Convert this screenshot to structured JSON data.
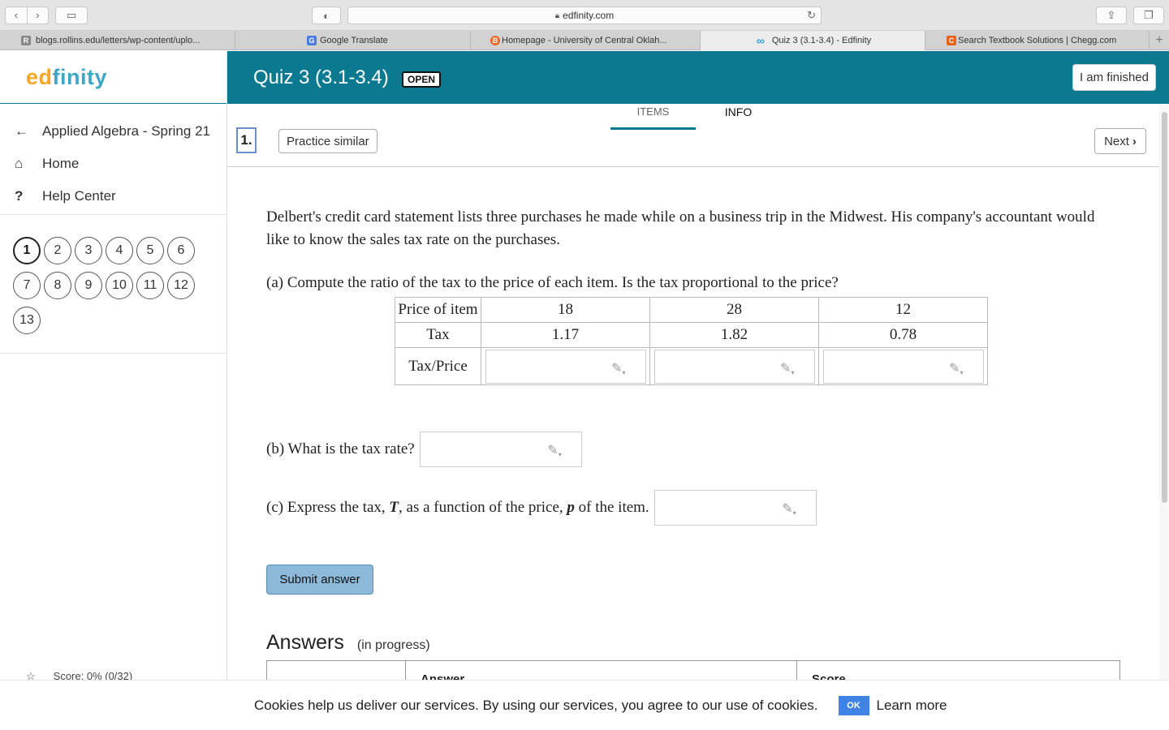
{
  "browser": {
    "url": "edfinity.com",
    "tabs": [
      {
        "label": "blogs.rollins.edu/letters/wp-content/uplo...",
        "favicon": "R",
        "color": "#888888"
      },
      {
        "label": "Google Translate",
        "favicon": "G",
        "color": "#4a7de0"
      },
      {
        "label": "Homepage - University of Central Oklah...",
        "favicon": "B",
        "color": "#e86a2b"
      },
      {
        "label": "Quiz 3 (3.1-3.4) - Edfinity",
        "favicon": "∞",
        "color": "#2a9fd6"
      },
      {
        "label": "Search Textbook Solutions | Chegg.com",
        "favicon": "C",
        "color": "#e8631a"
      }
    ]
  },
  "logo": {
    "part1": "ed",
    "part2": "finity"
  },
  "nav": {
    "course": "Applied Algebra - Spring 21",
    "home": "Home",
    "help": "Help Center"
  },
  "questions": {
    "row1": [
      "1",
      "2",
      "3",
      "4",
      "5",
      "6"
    ],
    "row2": [
      "7",
      "8",
      "9",
      "10",
      "11",
      "12"
    ],
    "row3": [
      "13"
    ],
    "current": "1"
  },
  "score": "Score: 0% (0/32)",
  "header": {
    "title": "Quiz 3 (3.1-3.4)",
    "badge": "OPEN",
    "finished": "I am finished"
  },
  "itabs": {
    "items": "ITEMS",
    "info": "INFO"
  },
  "question": {
    "number": "1.",
    "practice": "Practice similar",
    "next": "Next",
    "intro": "Delbert's credit card statement lists three purchases he made while on a business trip in the Midwest. His company's accountant would like to know the sales tax rate on the purchases.",
    "part_a": "(a) Compute the ratio of the tax to the price of each item. Is the tax proportional to the price?",
    "table": {
      "row_labels": [
        "Price of item",
        "Tax",
        "Tax/Price"
      ],
      "prices": [
        "18",
        "28",
        "12"
      ],
      "taxes": [
        "1.17",
        "1.82",
        "0.78"
      ]
    },
    "part_b": "(b) What is the tax rate?",
    "part_c_pre": "(c) Express the tax, ",
    "part_c_var1": "T",
    "part_c_mid": ", as a function of the price, ",
    "part_c_var2": "p",
    "part_c_post": " of the item.",
    "submit": "Submit answer"
  },
  "answers": {
    "title": "Answers",
    "status": "(in progress)",
    "columns": [
      "",
      "Answer",
      "Score"
    ]
  },
  "cookie": {
    "text": "Cookies help us deliver our services. By using our services, you agree to our use of cookies.",
    "ok": "OK",
    "learn": "Learn more"
  }
}
